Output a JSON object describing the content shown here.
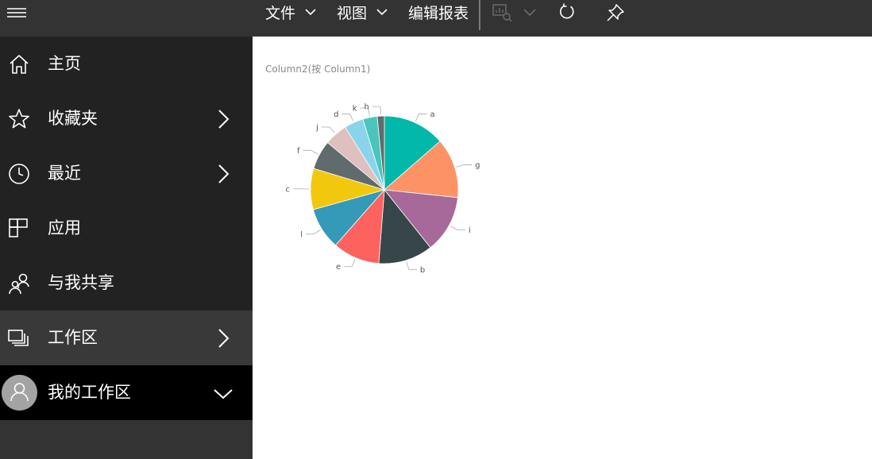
{
  "topbar": {
    "menu_items": [
      {
        "label": "文件",
        "has_dropdown": true
      },
      {
        "label": "视图",
        "has_dropdown": true
      },
      {
        "label": "编辑报表",
        "has_dropdown": false
      }
    ],
    "icons": [
      "visual-explore-icon",
      "refresh-icon",
      "pin-icon"
    ]
  },
  "sidebar": {
    "items": [
      {
        "label": "主页",
        "icon": "home-icon",
        "has_chevron": false
      },
      {
        "label": "收藏夹",
        "icon": "star-icon",
        "has_chevron": true
      },
      {
        "label": "最近",
        "icon": "clock-icon",
        "has_chevron": true
      },
      {
        "label": "应用",
        "icon": "apps-icon",
        "has_chevron": false
      },
      {
        "label": "与我共享",
        "icon": "shared-icon",
        "has_chevron": false
      },
      {
        "label": "工作区",
        "icon": "workspace-icon",
        "has_chevron": true
      },
      {
        "label": "我的工作区",
        "icon": "avatar-icon",
        "has_chevron": true
      }
    ]
  },
  "chart_data": {
    "type": "pie",
    "title": "Column2(按 Column1)",
    "legend": "none",
    "slices": [
      {
        "label": "a",
        "value": 13.9,
        "color": "#01B8AA"
      },
      {
        "label": "g",
        "value": 13.4,
        "color": "#FD9365"
      },
      {
        "label": "i",
        "value": 12.9,
        "color": "#A66999"
      },
      {
        "label": "b",
        "value": 12.2,
        "color": "#374649"
      },
      {
        "label": "e",
        "value": 10.5,
        "color": "#FD625E"
      },
      {
        "label": "l",
        "value": 9.4,
        "color": "#3599B8"
      },
      {
        "label": "c",
        "value": 9.2,
        "color": "#F2C80F"
      },
      {
        "label": "f",
        "value": 6.5,
        "color": "#5F6B6D"
      },
      {
        "label": "j",
        "value": 5.2,
        "color": "#DFBFBF"
      },
      {
        "label": "d",
        "value": 4.3,
        "color": "#8AD4EB"
      },
      {
        "label": "k",
        "value": 3.2,
        "color": "#4AC5BB"
      },
      {
        "label": "h",
        "value": 1.6,
        "color": "#5F6B6D"
      }
    ]
  }
}
